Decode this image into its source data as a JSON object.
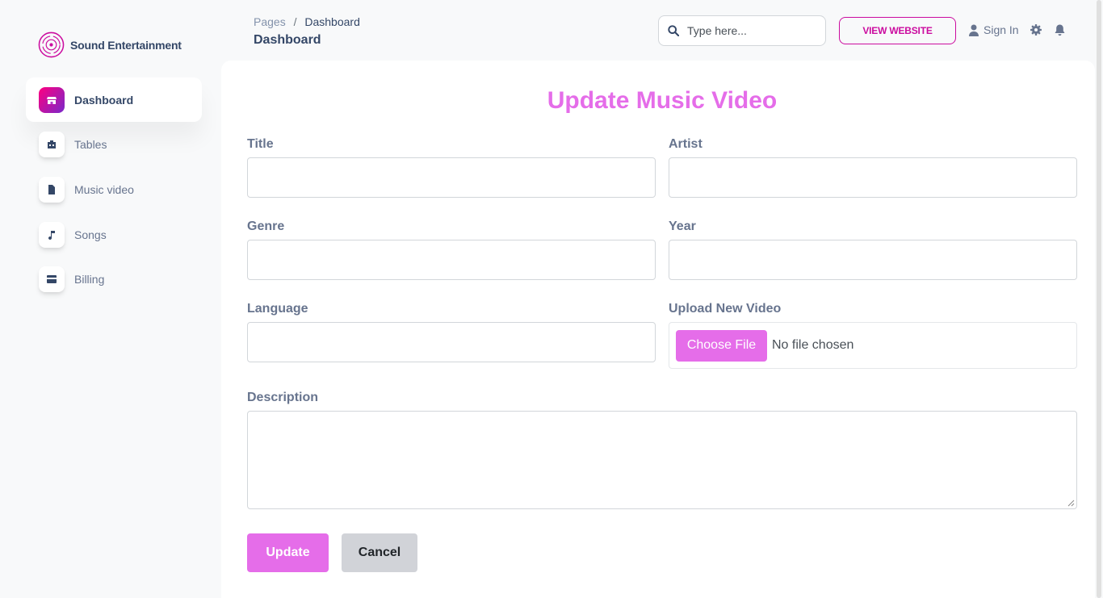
{
  "brand": {
    "name": "Sound Entertainment",
    "logo_icon": "vinyl-disc-icon"
  },
  "sidebar": {
    "items": [
      {
        "label": "Dashboard",
        "icon": "shop-icon",
        "active": true
      },
      {
        "label": "Tables",
        "icon": "office-icon",
        "active": false
      },
      {
        "label": "Music video",
        "icon": "document-icon",
        "active": false
      },
      {
        "label": "Songs",
        "icon": "music-note-icon",
        "active": false
      },
      {
        "label": "Billing",
        "icon": "credit-card-icon",
        "active": false
      }
    ]
  },
  "header": {
    "breadcrumb_root": "Pages",
    "breadcrumb_separator": "/",
    "breadcrumb_current": "Dashboard",
    "title": "Dashboard",
    "search_placeholder": "Type here...",
    "view_website_label": "VIEW WEBSITE",
    "sign_in_label": "Sign In"
  },
  "form": {
    "title": "Update Music Video",
    "fields": {
      "title_label": "Title",
      "artist_label": "Artist",
      "genre_label": "Genre",
      "year_label": "Year",
      "language_label": "Language",
      "upload_label": "Upload New Video",
      "description_label": "Description"
    },
    "file": {
      "button_label": "Choose File",
      "status": "No file chosen"
    },
    "update_label": "Update",
    "cancel_label": "Cancel"
  },
  "colors": {
    "accent": "#e56de9",
    "brand_pink": "#cb0c9f",
    "text_dark": "#344767",
    "text_muted": "#67748e"
  }
}
